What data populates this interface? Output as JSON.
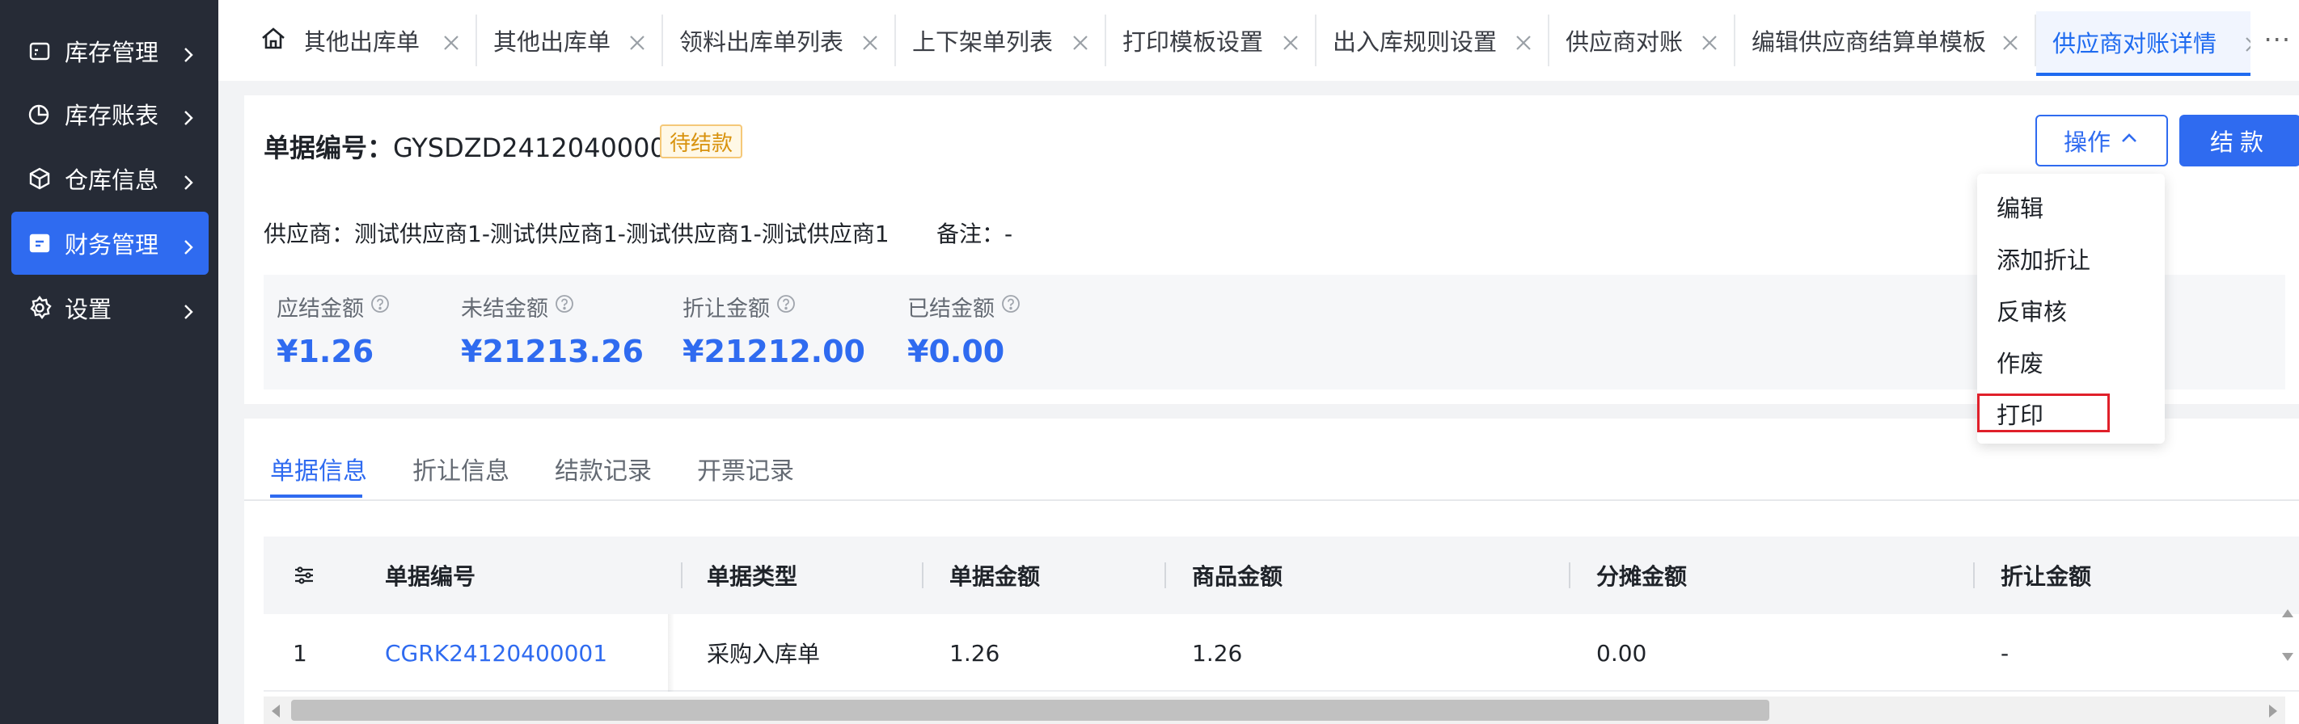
{
  "sidebar": {
    "items": [
      {
        "label": "库存管理",
        "icon": "inventory-icon"
      },
      {
        "label": "库存账表",
        "icon": "pie-chart-icon"
      },
      {
        "label": "仓库信息",
        "icon": "box-icon"
      },
      {
        "label": "财务管理",
        "icon": "finance-icon",
        "active": true
      },
      {
        "label": "设置",
        "icon": "gear-icon"
      }
    ]
  },
  "tabs": {
    "items": [
      {
        "label": "其他出库单"
      },
      {
        "label": "其他出库单"
      },
      {
        "label": "领料出库单列表"
      },
      {
        "label": "上下架单列表"
      },
      {
        "label": "打印模板设置"
      },
      {
        "label": "出入库规则设置"
      },
      {
        "label": "供应商对账"
      },
      {
        "label": "编辑供应商结算单模板"
      },
      {
        "label": "供应商对账详情",
        "active": true
      }
    ],
    "more": "···"
  },
  "header": {
    "doc_label": "单据编号：",
    "doc_no": "GYSDZD24120400003",
    "status": "待结款",
    "supplier_label": "供应商：",
    "supplier": "测试供应商1-测试供应商1-测试供应商1-测试供应商1",
    "remark_label": "备注：",
    "remark": "-",
    "ops_label": "操作",
    "pay_label": "结款"
  },
  "summary": [
    {
      "label": "应结金额",
      "value": "¥1.26"
    },
    {
      "label": "未结金额",
      "value": "¥21213.26"
    },
    {
      "label": "折让金额",
      "value": "¥21212.00"
    },
    {
      "label": "已结金额",
      "value": "¥0.00"
    }
  ],
  "ops_menu": [
    "编辑",
    "添加折让",
    "反审核",
    "作废",
    "打印"
  ],
  "detail_tabs": [
    "单据信息",
    "折让信息",
    "结款记录",
    "开票记录"
  ],
  "table": {
    "columns": [
      "单据编号",
      "单据类型",
      "单据金额",
      "商品金额",
      "分摊金额",
      "折让金额"
    ],
    "rows": [
      {
        "idx": "1",
        "doc_no": "CGRK24120400001",
        "type": "采购入库单",
        "doc_amount": "1.26",
        "goods_amount": "1.26",
        "alloc_amount": "0.00",
        "discount_amount": "-"
      }
    ]
  },
  "colors": {
    "primary": "#2f6bf0",
    "sidebar_bg": "#262b36",
    "status_text": "#d8920e",
    "highlight": "#e0202a"
  }
}
